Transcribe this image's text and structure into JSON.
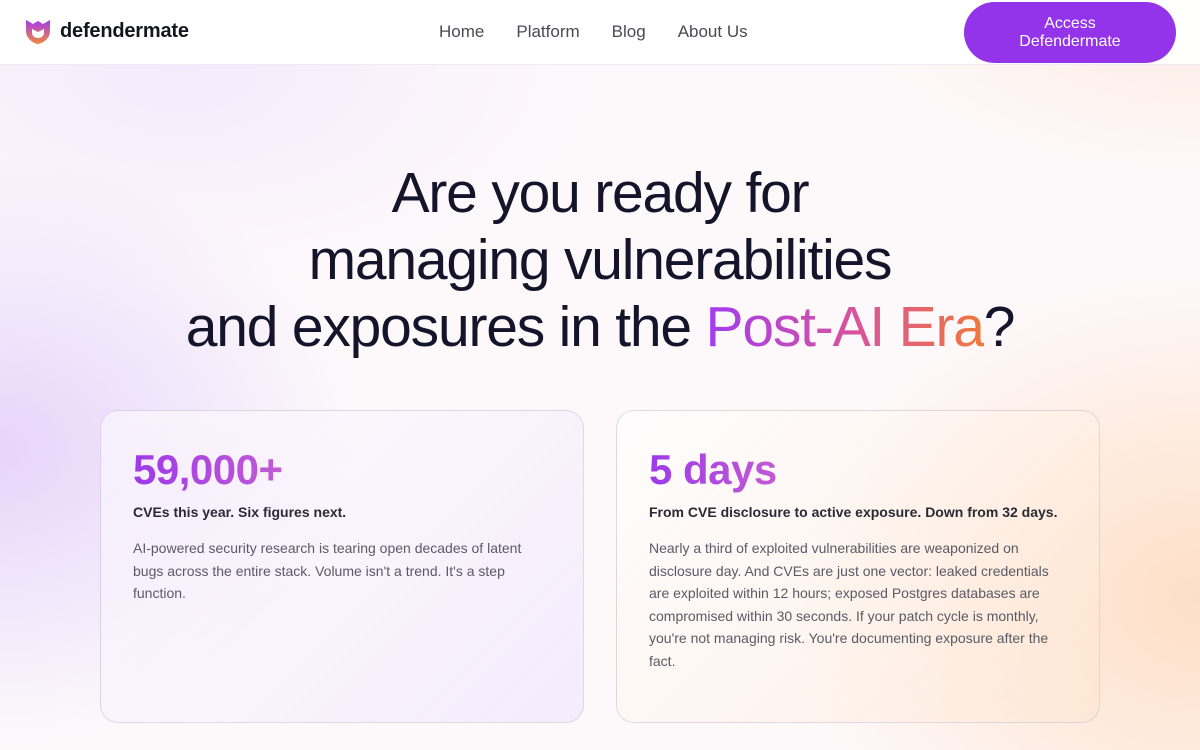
{
  "header": {
    "brand": "defendermate",
    "nav": [
      {
        "label": "Home"
      },
      {
        "label": "Platform"
      },
      {
        "label": "Blog"
      },
      {
        "label": "About Us"
      }
    ],
    "cta_label": "Access Defendermate"
  },
  "hero": {
    "line1": "Are you ready for",
    "line2": "managing vulnerabilities",
    "line3_pre": "and exposures in the ",
    "line3_highlight": "Post-AI Era",
    "line3_post": "?"
  },
  "cards": [
    {
      "stat": "59,000+",
      "subtitle": "CVEs this year. Six figures next.",
      "body": "AI-powered security research is tearing open decades of latent bugs across the entire stack. Volume isn't a trend. It's a step function."
    },
    {
      "stat": "5 days",
      "subtitle": "From CVE disclosure to active exposure. Down from 32 days.",
      "body": "Nearly a third of exploited vulnerabilities are weaponized on disclosure day. And CVEs are just one vector: leaked credentials are exploited within 12 hours; exposed Postgres databases are compromised within 30 seconds. If your patch cycle is monthly, you're not managing risk. You're documenting exposure after the fact."
    }
  ],
  "colors": {
    "accent": "#9333ea",
    "gradient_start": "#a23cf0",
    "gradient_end": "#f0793a",
    "heading": "#14142a"
  },
  "icons": {
    "logo": "shield-logo-icon"
  }
}
